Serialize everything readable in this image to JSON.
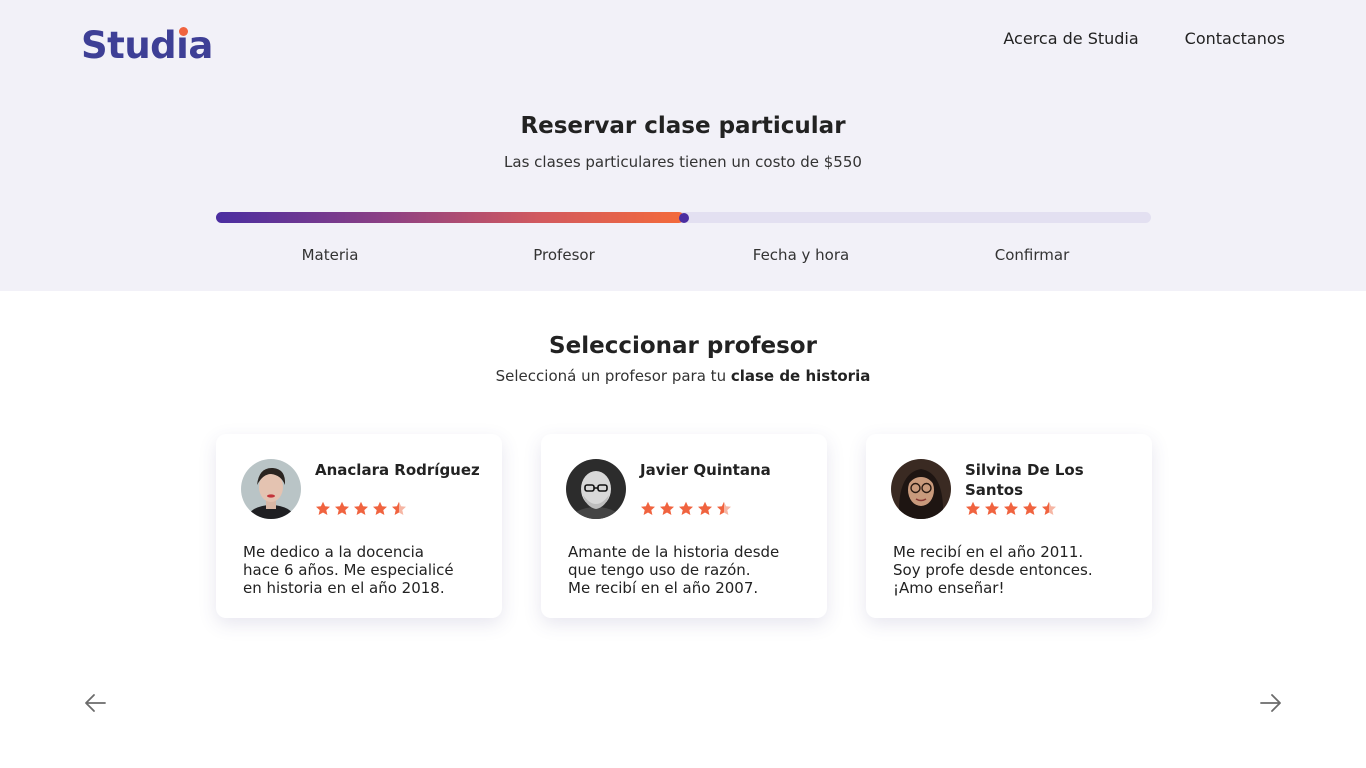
{
  "brand": {
    "logo_text_a": "Stud",
    "logo_text_i": "ı",
    "logo_text_b": "a",
    "logo_dot_color": "#f0633f",
    "logo_color": "#3e3f96"
  },
  "nav": [
    {
      "label": "Acerca de Studia"
    },
    {
      "label": "Contactanos"
    }
  ],
  "header": {
    "title": "Reservar clase particular",
    "subtitle": "Las clases particulares tienen un costo de $550"
  },
  "progress": {
    "value_fraction": 0.5
  },
  "steps": [
    {
      "label": "Materia",
      "active": false
    },
    {
      "label": "Profesor",
      "active": true
    },
    {
      "label": "Fecha y hora",
      "active": false
    },
    {
      "label": "Confirmar",
      "active": false
    }
  ],
  "section": {
    "title": "Seleccionar profesor",
    "subtitle_prefix": "Seleccioná un profesor para tu ",
    "subtitle_bold": "clase de historia"
  },
  "teachers": [
    {
      "name": "Anaclara Rodríguez",
      "rating": 4.5,
      "description": "Me dedico a la docencia\nhace 6 años. Me especialicé\nen historia en el año 2018.",
      "avatar_icon": "woman-portrait-icon"
    },
    {
      "name": "Javier Quintana",
      "rating": 4.5,
      "description": "Amante de la historia desde\nque tengo uso de razón.\nMe recibí en el año 2007.",
      "avatar_icon": "man-portrait-icon"
    },
    {
      "name": "Silvina De Los Santos",
      "rating": 4.5,
      "description": "Me recibí en el año 2011.\nSoy profe desde entonces.\n¡Amo enseñar!",
      "avatar_icon": "woman-glasses-portrait-icon"
    }
  ],
  "carousel": {
    "prev_icon": "arrow-left-icon",
    "next_icon": "arrow-right-icon"
  },
  "colors": {
    "accent": "#f0633f",
    "primary": "#3e3f96",
    "star": "#f0633f"
  }
}
